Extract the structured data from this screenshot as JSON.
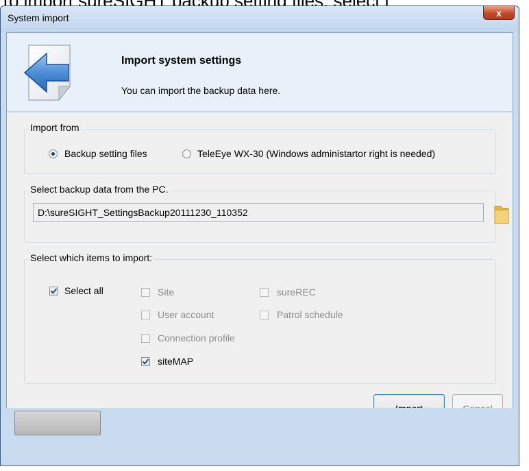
{
  "background": {
    "text": "To import sureSIGHT backup setting files, select ["
  },
  "window": {
    "title": "System import",
    "close_label": "x"
  },
  "banner": {
    "title": "Import system settings",
    "subtitle": "You can import the backup data here.",
    "icon": "import-arrow-document-icon"
  },
  "import_from": {
    "legend": "Import from",
    "options": [
      {
        "label": "Backup setting files",
        "selected": true
      },
      {
        "label": "TeleEye WX-30 (Windows administartor right is needed)",
        "selected": false
      }
    ]
  },
  "backup_data": {
    "legend": "Select backup data from the PC.",
    "path": "D:\\sureSIGHT_SettingsBackup20111230_110352",
    "browse_icon": "folder-icon"
  },
  "items": {
    "legend": "Select which items to import:",
    "select_all": {
      "label": "Select all",
      "checked": true
    },
    "list": [
      {
        "label": "Site",
        "checked": false,
        "enabled": false
      },
      {
        "label": "sureREC",
        "checked": false,
        "enabled": false
      },
      {
        "label": "User account",
        "checked": false,
        "enabled": false
      },
      {
        "label": "Patrol schedule",
        "checked": false,
        "enabled": false
      },
      {
        "label": "Connection profile",
        "checked": false,
        "enabled": false
      },
      {
        "label": "siteMAP",
        "checked": true,
        "enabled": true
      }
    ]
  },
  "buttons": {
    "import": "Import",
    "cancel": "Cancel"
  }
}
